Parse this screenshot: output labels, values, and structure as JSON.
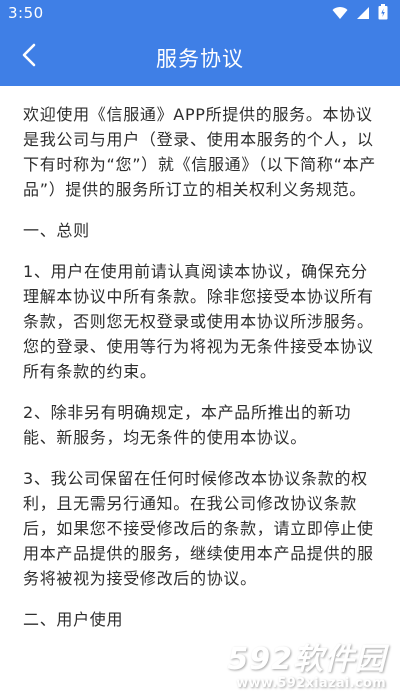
{
  "status_bar": {
    "time": "3:50",
    "icons": [
      "wifi-icon",
      "signal-icon",
      "battery-icon"
    ]
  },
  "header": {
    "title": "服务协议",
    "back_icon": "back-arrow-icon",
    "background_color": "#3f7fe6"
  },
  "content": {
    "intro": "欢迎使用《信服通》APP所提供的服务。本协议是我公司与用户（登录、使用本服务的个人，以下有时称为“您”）就《信服通》（以下简称“本产品”）提供的服务所订立的相关权利义务规范。",
    "section1_title": "一、总则",
    "clause1": "1、用户在使用前请认真阅读本协议，确保充分理解本协议中所有条款。除非您接受本协议所有条款，否则您无权登录或使用本协议所涉服务。您的登录、使用等行为将视为无条件接受本协议所有条款的约束。",
    "clause2": "2、除非另有明确规定，本产品所推出的新功能、新服务，均无条件的使用本协议。",
    "clause3": "3、我公司保留在任何时候修改本协议条款的权利，且无需另行通知。在我公司修改协议条款后，如果您不接受修改后的条款，请立即停止使用本产品提供的服务，继续使用本产品提供的服务将被视为接受修改后的协议。",
    "section2_title": "二、用户使用"
  },
  "watermark": {
    "logo_text": "592软件园",
    "url": "www.592xiazai.com"
  }
}
